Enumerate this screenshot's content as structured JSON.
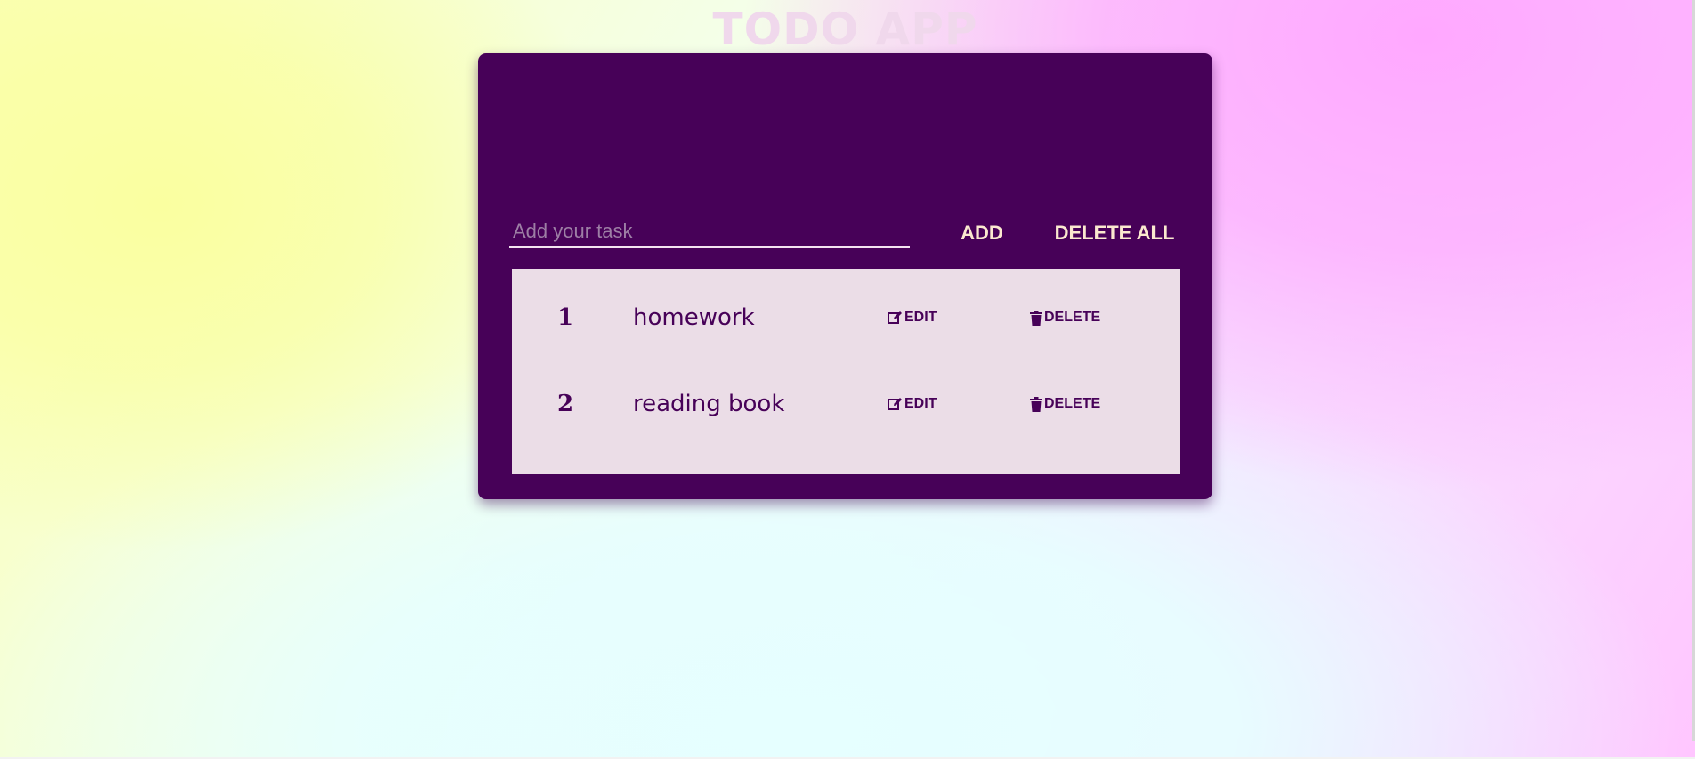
{
  "app": {
    "title": "TODO APP"
  },
  "input": {
    "placeholder": "Add your task",
    "value": ""
  },
  "buttons": {
    "add": "ADD",
    "delete_all": "DELETE ALL"
  },
  "tasks": [
    {
      "number": "1",
      "text": "homework",
      "edit_label": "EDIT",
      "delete_label": "DELETE"
    },
    {
      "number": "2",
      "text": "reading book",
      "edit_label": "EDIT",
      "delete_label": "DELETE"
    }
  ],
  "icons": {
    "edit": "edit-icon",
    "delete": "trash-icon"
  },
  "colors": {
    "card_background": "#470158",
    "list_background": "#ebdde7",
    "title_text": "#f0d8ec",
    "button_text": "#fbe9cf",
    "item_text": "#470158"
  }
}
